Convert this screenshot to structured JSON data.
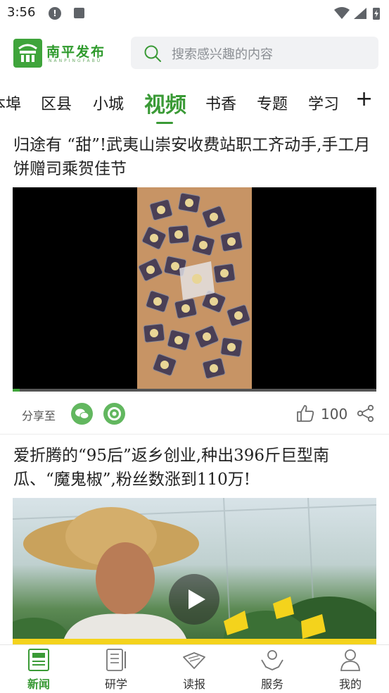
{
  "status_bar": {
    "time": "3:56"
  },
  "header": {
    "logo_text": "南平发布",
    "logo_subtext": "NANPINGFABU",
    "search_placeholder": "搜索感兴趣的内容"
  },
  "tabs": {
    "items": [
      "本埠",
      "区县",
      "小城",
      "视频",
      "书香",
      "专题",
      "学习"
    ],
    "active": "视频",
    "add_label": "+"
  },
  "articles": [
    {
      "title": "归途有 “甜”!武夷山崇安收费站职工齐动手,手工月饼赠司乘贺佳节",
      "type": "video",
      "video_progress": 0.02,
      "share_label": "分享至",
      "likes": "100"
    },
    {
      "title": "爱折腾的“95后”返乡创业,种出396斤巨型南瓜、“魔鬼椒”,粉丝数涨到110万!",
      "type": "video-cover"
    }
  ],
  "bottom_nav": {
    "items": [
      {
        "label": "新闻",
        "icon": "newspaper-icon",
        "active": true
      },
      {
        "label": "研学",
        "icon": "notebook-icon",
        "active": false
      },
      {
        "label": "读报",
        "icon": "read-paper-icon",
        "active": false
      },
      {
        "label": "服务",
        "icon": "service-hands-icon",
        "active": false
      },
      {
        "label": "我的",
        "icon": "person-icon",
        "active": false
      }
    ]
  },
  "colors": {
    "brand_green": "#3a9a36",
    "text_dark": "#222222",
    "search_bg": "#f1f2f4"
  }
}
